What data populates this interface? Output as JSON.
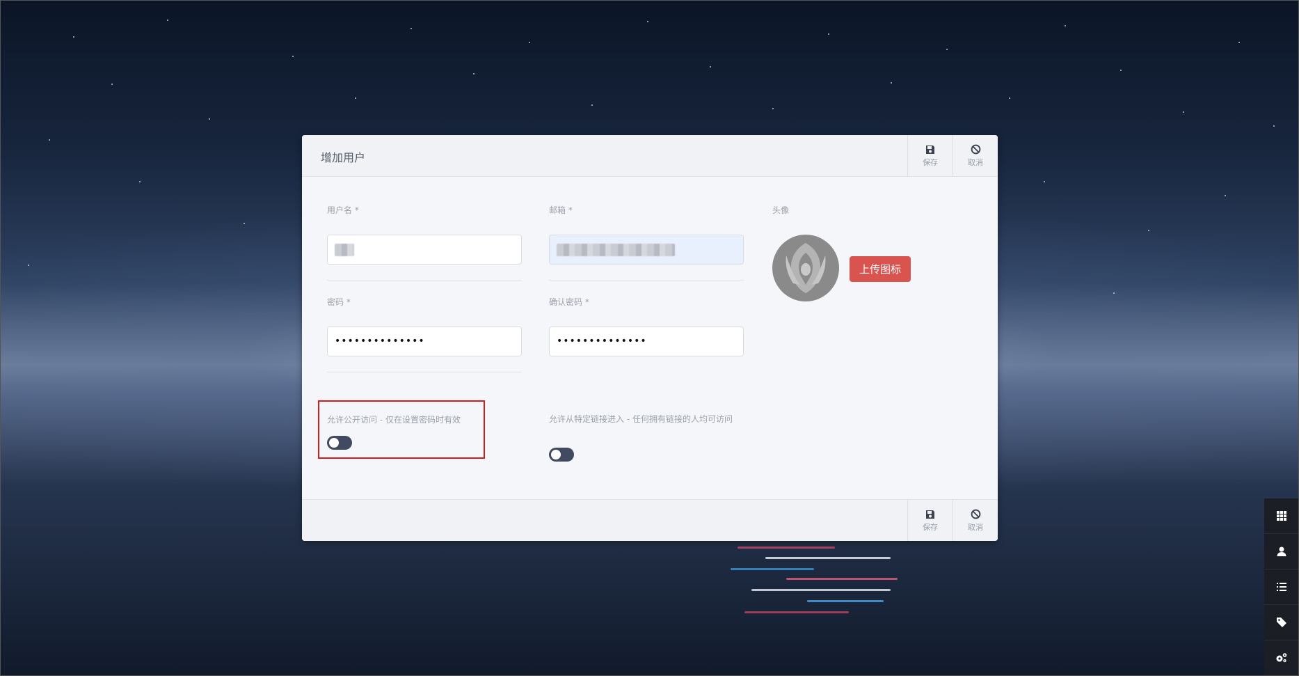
{
  "dialog": {
    "title": "增加用户",
    "header_actions": {
      "save_label": "保存",
      "cancel_label": "取消"
    },
    "footer_actions": {
      "save_label": "保存",
      "cancel_label": "取消"
    }
  },
  "form": {
    "username": {
      "label": "用户名 *"
    },
    "email": {
      "label": "邮箱 *"
    },
    "password": {
      "label": "密码 *",
      "value": "••••••••••••••"
    },
    "confirm_password": {
      "label": "确认密码 *",
      "value": "••••••••••••••"
    },
    "avatar": {
      "label": "头像",
      "upload_label": "上传图标"
    },
    "public_access": {
      "label": "允许公开访问 - 仅在设置密码时有效",
      "enabled": false
    },
    "link_access": {
      "label": "允许从特定链接进入 - 任何拥有链接的人均可访问",
      "enabled": false
    }
  },
  "sidebar": {
    "items": [
      {
        "icon": "grid-icon"
      },
      {
        "icon": "user-icon"
      },
      {
        "icon": "list-icon"
      },
      {
        "icon": "tag-icon"
      },
      {
        "icon": "gears-icon"
      }
    ]
  },
  "colors": {
    "upload_button": "#d9534f",
    "highlight_border": "#d51c1c",
    "toggle_off": "#424a5f",
    "sidebar_bg": "#1b1e24"
  }
}
